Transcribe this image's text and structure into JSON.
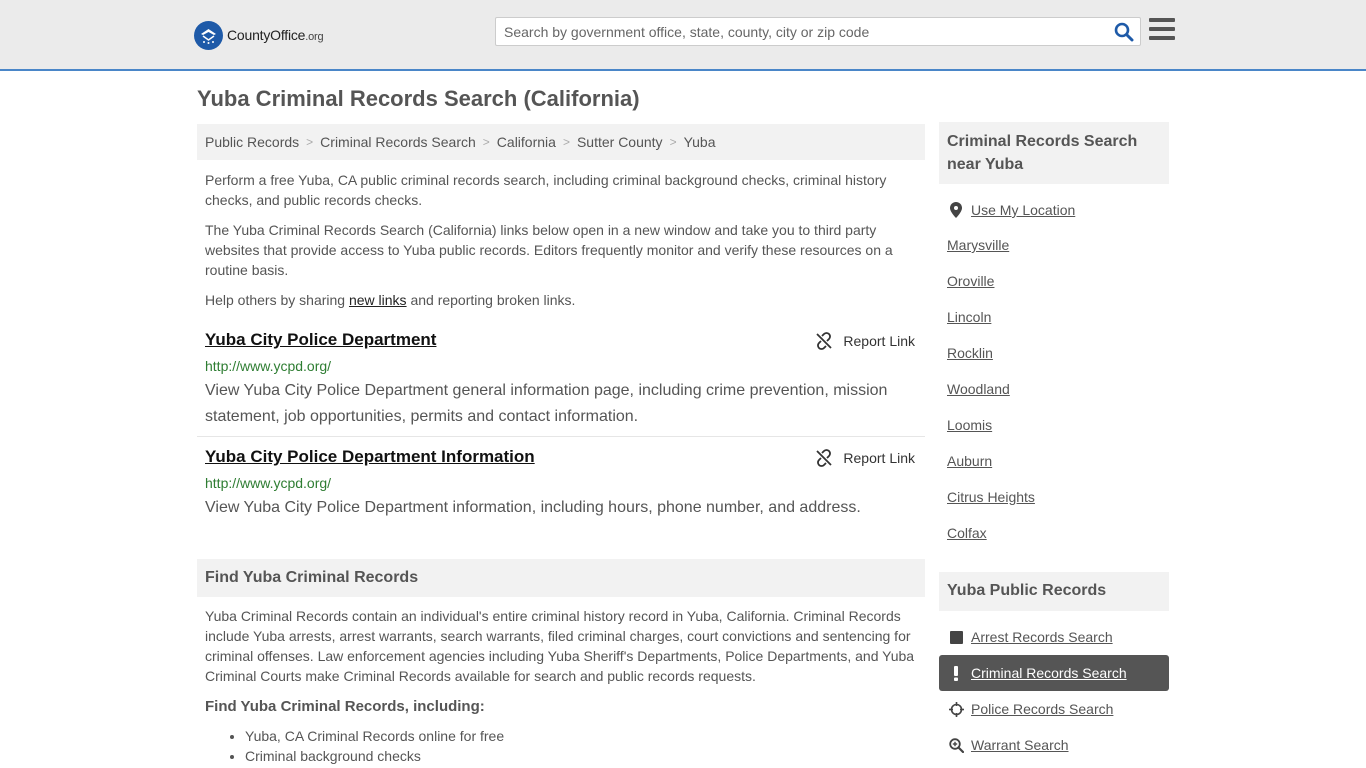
{
  "header": {
    "logo_text": "CountyOffice",
    "logo_suffix": ".org",
    "search_placeholder": "Search by government office, state, county, city or zip code"
  },
  "page_title": "Yuba Criminal Records Search (California)",
  "breadcrumb": [
    "Public Records",
    "Criminal Records Search",
    "California",
    "Sutter County",
    "Yuba"
  ],
  "intro": {
    "p1": "Perform a free Yuba, CA public criminal records search, including criminal background checks, criminal history checks, and public records checks.",
    "p2": "The Yuba Criminal Records Search (California) links below open in a new window and take you to third party websites that provide access to Yuba public records. Editors frequently monitor and verify these resources on a routine basis.",
    "p3_before": "Help others by sharing ",
    "p3_link": "new links",
    "p3_after": " and reporting broken links."
  },
  "report_label": "Report Link",
  "results": [
    {
      "title": "Yuba City Police Department",
      "url": "http://www.ycpd.org/",
      "desc": "View Yuba City Police Department general information page, including crime prevention, mission statement, job opportunities, permits and contact information."
    },
    {
      "title": "Yuba City Police Department Information",
      "url": "http://www.ycpd.org/",
      "desc": "View Yuba City Police Department information, including hours, phone number, and address."
    }
  ],
  "find_section": {
    "heading": "Find Yuba Criminal Records",
    "body": "Yuba Criminal Records contain an individual's entire criminal history record in Yuba, California. Criminal Records include Yuba arrests, arrest warrants, search warrants, filed criminal charges, court convictions and sentencing for criminal offenses. Law enforcement agencies including Yuba Sheriff's Departments, Police Departments, and Yuba Criminal Courts make Criminal Records available for search and public records requests.",
    "subheading": "Find Yuba Criminal Records, including:",
    "bullets": [
      "Yuba, CA Criminal Records online for free",
      "Criminal background checks"
    ]
  },
  "sidebar": {
    "nearby_heading": "Criminal Records Search near Yuba",
    "use_location": "Use My Location",
    "nearby": [
      "Marysville",
      "Oroville",
      "Lincoln",
      "Rocklin",
      "Woodland",
      "Loomis",
      "Auburn",
      "Citrus Heights",
      "Colfax"
    ],
    "public_heading": "Yuba Public Records",
    "public_links": [
      {
        "label": "Arrest Records Search",
        "icon": "square-icon"
      },
      {
        "label": "Criminal Records Search",
        "icon": "exclamation-icon"
      },
      {
        "label": "Police Records Search",
        "icon": "crosshair-icon"
      },
      {
        "label": "Warrant Search",
        "icon": "magnifier-plus-icon"
      }
    ]
  },
  "colors": {
    "header_bg": "#ebebeb",
    "accent_blue": "#1e5aa8",
    "url_green": "#2e7d32",
    "active_bg": "#555555"
  }
}
